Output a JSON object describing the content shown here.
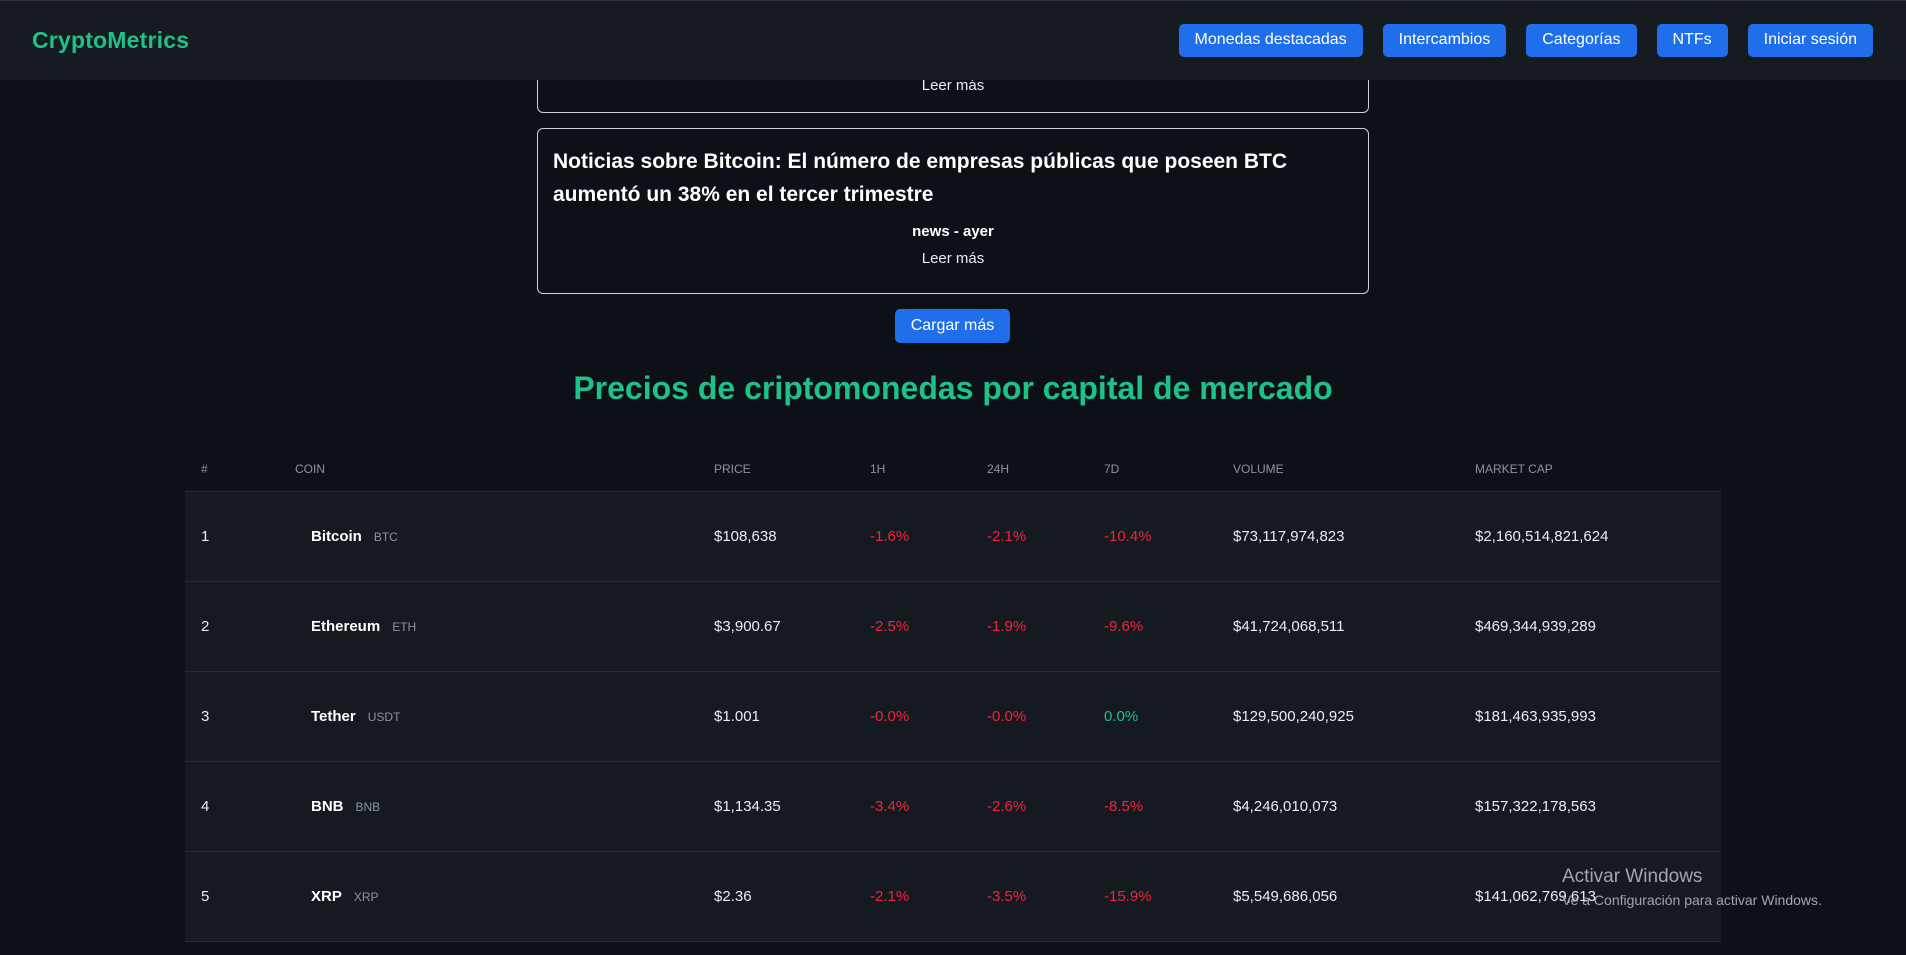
{
  "header": {
    "brand": "CryptoMetrics",
    "nav": [
      {
        "label": "Monedas destacadas"
      },
      {
        "label": "Intercambios"
      },
      {
        "label": "Categorías"
      },
      {
        "label": "NTFs"
      },
      {
        "label": "Iniciar sesión"
      }
    ]
  },
  "news": {
    "partial_card": {
      "read_more": "Leer más"
    },
    "card": {
      "title": "Noticias sobre Bitcoin: El número de empresas públicas que poseen BTC aumentó un 38% en el tercer trimestre",
      "meta": "news - ayer",
      "read_more": "Leer más"
    },
    "load_more": "Cargar más"
  },
  "market": {
    "title": "Precios de criptomonedas por capital de mercado",
    "columns": [
      "#",
      "COIN",
      "PRICE",
      "1H",
      "24H",
      "7D",
      "VOLUME",
      "MARKET CAP"
    ],
    "rows": [
      {
        "rank": "1",
        "name": "Bitcoin",
        "symbol": "BTC",
        "price": "$108,638",
        "h1": "-1.6%",
        "h24": "-2.1%",
        "d7": "-10.4%",
        "volume": "$73,117,974,823",
        "market_cap": "$2,160,514,821,624"
      },
      {
        "rank": "2",
        "name": "Ethereum",
        "symbol": "ETH",
        "price": "$3,900.67",
        "h1": "-2.5%",
        "h24": "-1.9%",
        "d7": "-9.6%",
        "volume": "$41,724,068,511",
        "market_cap": "$469,344,939,289"
      },
      {
        "rank": "3",
        "name": "Tether",
        "symbol": "USDT",
        "price": "$1.001",
        "h1": "-0.0%",
        "h24": "-0.0%",
        "d7": "0.0%",
        "volume": "$129,500,240,925",
        "market_cap": "$181,463,935,993"
      },
      {
        "rank": "4",
        "name": "BNB",
        "symbol": "BNB",
        "price": "$1,134.35",
        "h1": "-3.4%",
        "h24": "-2.6%",
        "d7": "-8.5%",
        "volume": "$4,246,010,073",
        "market_cap": "$157,322,178,563"
      },
      {
        "rank": "5",
        "name": "XRP",
        "symbol": "XRP",
        "price": "$2.36",
        "h1": "-2.1%",
        "h24": "-3.5%",
        "d7": "-15.9%",
        "volume": "$5,549,686,056",
        "market_cap": "$141,062,769,613"
      }
    ]
  },
  "watermark": {
    "title": "Activar Windows",
    "subtitle": "Ve a Configuración para activar Windows."
  },
  "colors": {
    "accent": "#1fc18a",
    "button": "#1f6feb",
    "negative": "#f0243e",
    "positive": "#1fc18a",
    "background": "#0d1117"
  }
}
